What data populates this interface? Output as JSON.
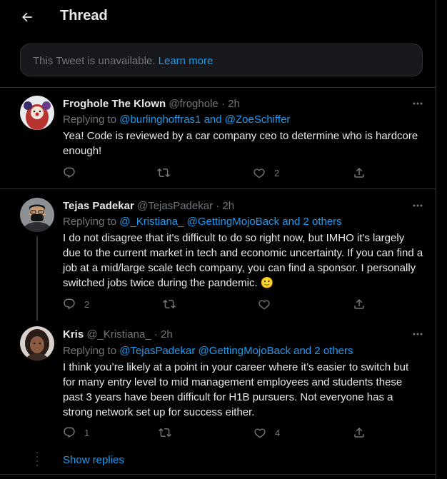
{
  "header": {
    "title": "Thread"
  },
  "unavailable": {
    "text": "This Tweet is unavailable.",
    "link": "Learn more"
  },
  "tweets": [
    {
      "name": "Froghole The Klown",
      "handle": "@froghole",
      "time": "2h",
      "replying_prefix": "Replying to",
      "replying_to": "@burlinghoffras1 and @ZoeSchiffer",
      "text": "Yea! Code is reviewed by a car company ceo to determine who is hardcore enough!",
      "replies": "",
      "retweets": "",
      "likes": "2"
    },
    {
      "name": "Tejas Padekar",
      "handle": "@TejasPadekar",
      "time": "2h",
      "replying_prefix": "Replying to",
      "replying_to": "@_Kristiana_ @GettingMojoBack  and 2 others",
      "text": "I do not disagree that it's difficult to do so right now, but IMHO it's largely due to the current market in tech and economic uncertainty. If you can find a job at a mid/large scale tech company, you can find a sponsor. I personally switched jobs twice during the pandemic. 🙂",
      "replies": "2",
      "retweets": "",
      "likes": ""
    },
    {
      "name": "Kris",
      "handle": "@_Kristiana_",
      "time": "2h",
      "replying_prefix": "Replying to",
      "replying_to": "@TejasPadekar @GettingMojoBack  and 2 others",
      "text": "I think you’re likely at a point in your career where it’s easier to switch but for many entry level to mid management employees and students these past 3 years have been difficult for H1B pursuers. Not everyone has a strong network set up for success either.",
      "replies": "1",
      "retweets": "",
      "likes": "4"
    }
  ],
  "show_replies": "Show replies",
  "separator": "·"
}
